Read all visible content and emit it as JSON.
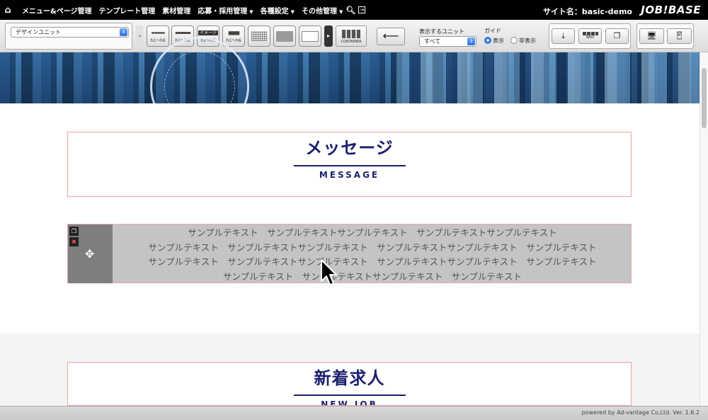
{
  "topnav": {
    "home_icon": "home-icon",
    "items": [
      {
        "label": "メニュー&ページ管理",
        "has_caret": false
      },
      {
        "label": "テンプレート管理",
        "has_caret": false
      },
      {
        "label": "素材管理",
        "has_caret": false
      },
      {
        "label": "応募・採用管理",
        "has_caret": true
      },
      {
        "label": "各種設定",
        "has_caret": true
      },
      {
        "label": "その他管理",
        "has_caret": true
      }
    ],
    "site_name": "サイト名：basic-demo",
    "brand": "JOB!BASE"
  },
  "toolbar": {
    "unit_select": "デザインユニット",
    "unit_buttons": [
      {
        "icon": "heading-unit-icon",
        "label": "h1〜h6",
        "style": "bars"
      },
      {
        "icon": "heading-unit-icon",
        "label": "h1〜h6",
        "style": "dots"
      },
      {
        "icon": "image-heading-unit-icon",
        "label": "h1〜h6",
        "tag": "イメージ"
      },
      {
        "icon": "heading-unit-icon",
        "label": "h1〜h6",
        "style": "block"
      },
      {
        "icon": "text-grid-icon",
        "label": ""
      },
      {
        "icon": "gray-box-icon",
        "label": ""
      },
      {
        "icon": "frame-box-icon",
        "label": ""
      }
    ],
    "container_label": "CONTAINER",
    "display_unit_label": "表示するユニット",
    "display_unit_value": "すべて",
    "guide_label": "ガイド",
    "guide_show": "表示",
    "guide_hide": "非表示",
    "guide_selected": "表示",
    "navi_label": "NAVI"
  },
  "content": {
    "message_title": "メッセージ",
    "message_subtitle": "MESSAGE",
    "sample_lines": [
      "サンプルテキスト　サンプルテキストサンプルテキスト　サンプルテキストサンプルテキスト",
      "サンプルテキスト　サンプルテキストサンプルテキスト　サンプルテキストサンプルテキスト　サンプルテキスト",
      "サンプルテキスト　サンプルテキストサンプルテキスト　サンプルテキストサンプルテキスト　サンプルテキスト",
      "サンプルテキスト　サンプルテキストサンプルテキスト　サンプルテキスト"
    ],
    "new_jobs_title": "新着求人",
    "new_jobs_subtitle": "NEW JOB"
  },
  "footer": {
    "text": "powered by Ad-vantage Co,Ltd. Ver. 1.6.2"
  }
}
